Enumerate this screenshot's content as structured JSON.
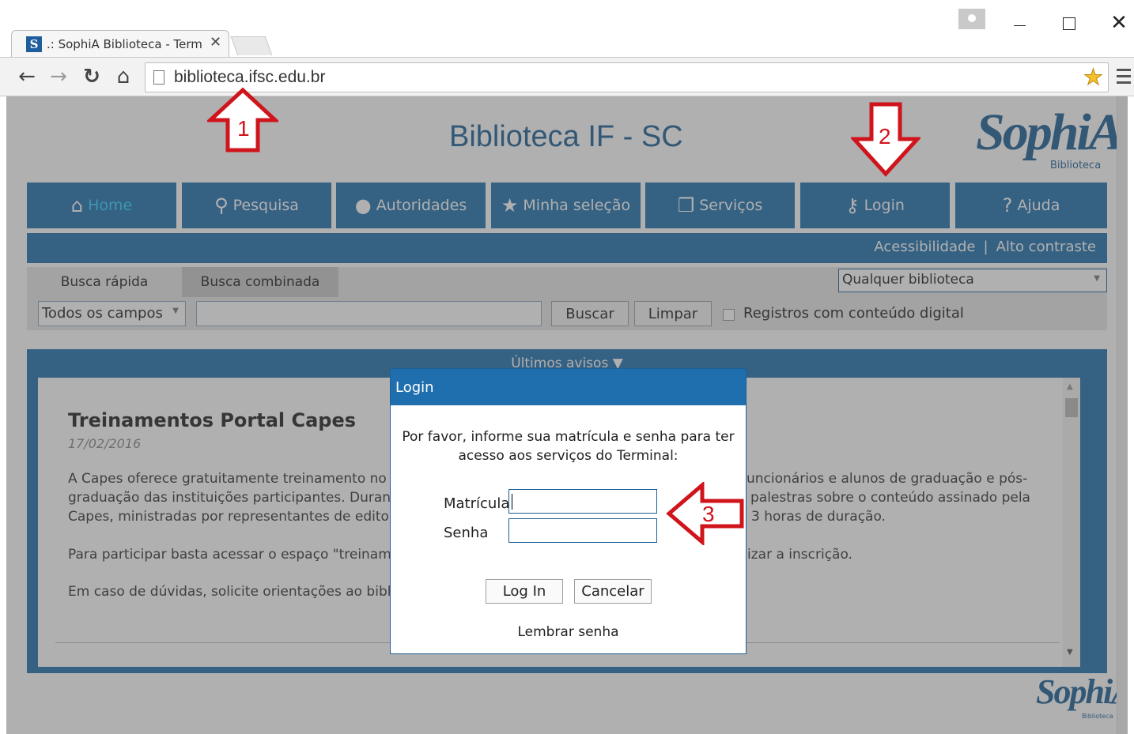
{
  "browser": {
    "tab_title": ".: SophiA Biblioteca - Term",
    "tab_favicon": "S",
    "url": "biblioteca.ifsc.edu.br"
  },
  "site": {
    "title": "Biblioteca IF - SC",
    "logo_text": "SophiA",
    "logo_sub": "Biblioteca"
  },
  "nav": {
    "items": [
      {
        "label": "Home",
        "icon": "home-icon"
      },
      {
        "label": "Pesquisa",
        "icon": "search-icon"
      },
      {
        "label": "Autoridades",
        "icon": "user-icon"
      },
      {
        "label": "Minha seleção",
        "icon": "star-icon"
      },
      {
        "label": "Serviços",
        "icon": "services-icon"
      },
      {
        "label": "Login",
        "icon": "key-icon"
      },
      {
        "label": "Ajuda",
        "icon": "help-icon"
      }
    ]
  },
  "access_bar": {
    "accessibility": "Acessibilidade",
    "separator": "|",
    "high_contrast": "Alto contraste"
  },
  "search": {
    "tab_quick": "Busca rápida",
    "tab_combined": "Busca combinada",
    "library_select": "Qualquer biblioteca",
    "field_select": "Todos os campos",
    "search_button": "Buscar",
    "clear_button": "Limpar",
    "digital_label": "Registros com conteúdo digital"
  },
  "notices": {
    "header": "Últimos avisos",
    "title": "Treinamentos Portal Capes",
    "date": "17/02/2016",
    "line1_left": "A Capes oferece gratuitamente treinamento no us",
    "line1_right": "uncionários e alunos de graduação e pós-",
    "line2_left": "graduação das instituições participantes. Durante o",
    "line2_right": "palestras sobre o conteúdo assinado pela",
    "line3_left": "Capes, ministradas por representantes de editoras",
    "line3_right": "3 horas de duração.",
    "line4_left": "Para participar basta acessar o espaço \"treinament",
    "line4_right": "izar a inscrição.",
    "line5_left": "Em caso de dúvidas, solicite orientações ao bibliot"
  },
  "login_modal": {
    "title": "Login",
    "message_line1": "Por favor, informe sua matrícula e senha para ter",
    "message_line2": "acesso aos serviços do Terminal:",
    "matricula_label": "Matrícula",
    "senha_label": "Senha",
    "login_button": "Log In",
    "cancel_button": "Cancelar",
    "remember_link": "Lembrar senha"
  },
  "annotations": {
    "n1": "1",
    "n2": "2",
    "n3": "3",
    "color": "#d0141c"
  },
  "colors": {
    "brand_blue": "#1f6fae",
    "logo_blue": "#1d5f96",
    "home_highlight": "#2fd1ff"
  }
}
